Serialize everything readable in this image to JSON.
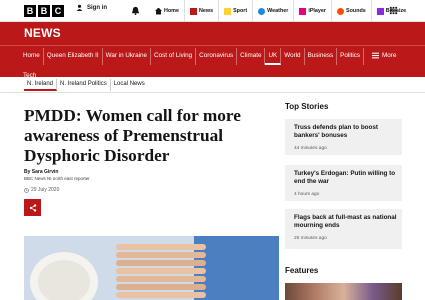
{
  "brand": {
    "letters": [
      "B",
      "B",
      "C"
    ]
  },
  "account": {
    "signin_label": "Sign in"
  },
  "top_nav": [
    {
      "label": "Home",
      "icon": "home-icon"
    },
    {
      "label": "News",
      "icon": "news-icon"
    },
    {
      "label": "Sport",
      "icon": "sport-icon"
    },
    {
      "label": "Weather",
      "icon": "weather-icon"
    },
    {
      "label": "iPlayer",
      "icon": "iplayer-icon"
    },
    {
      "label": "Sounds",
      "icon": "sounds-icon"
    },
    {
      "label": "Bitesize",
      "icon": "bitesize-icon"
    }
  ],
  "section": {
    "title": "NEWS"
  },
  "main_nav": [
    "Home",
    "Queen Elizabeth II",
    "War in Ukraine",
    "Cost of Living",
    "Coronavirus",
    "Climate",
    "UK",
    "World",
    "Business",
    "Politics"
  ],
  "main_nav_active": "UK",
  "main_nav_row2": [
    "Tech"
  ],
  "more_label": "More",
  "sub_nav": [
    "N. Ireland",
    "N. Ireland Politics",
    "Local News"
  ],
  "article": {
    "headline": "PMDD: Women call for more awareness of Premenstrual Dysphoric Disorder",
    "author": "By Sara Girvin",
    "role": "BBC News NI north east reporter",
    "date": "29 July 2020"
  },
  "sidebar": {
    "title": "Top Stories",
    "stories": [
      {
        "title": "Truss defends plan to boost bankers' bonuses",
        "time": "44 minutes ago"
      },
      {
        "title": "Turkey's Erdogan: Putin willing to end the war",
        "time": "4 hours ago"
      },
      {
        "title": "Flags back at full-mast as national mourning ends",
        "time": "25 minutes ago"
      }
    ],
    "features_title": "Features"
  },
  "colors": {
    "brand_red": "#bb1919",
    "accent_yellow": "#ffd230"
  }
}
